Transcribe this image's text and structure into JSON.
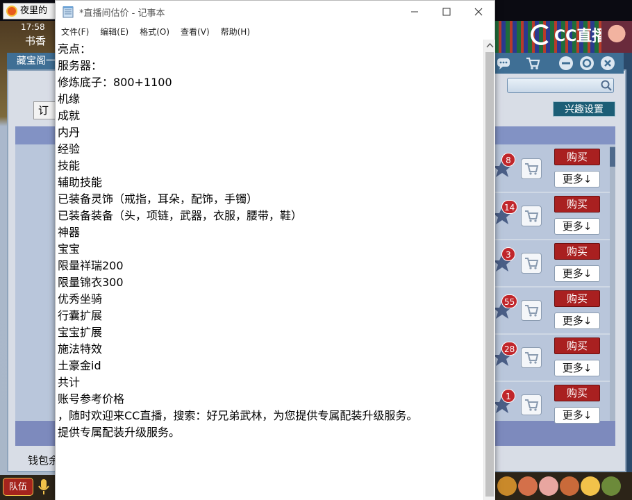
{
  "colors": {
    "buy_button": "#a92020",
    "badge": "#c0262b",
    "game_header": "#3f6f95",
    "list_header": "#8292c4",
    "notepad_bg": "#ffffff"
  },
  "game": {
    "tab_title": "夜里的",
    "clock": "17:58",
    "bookstore_label": "书香",
    "header_label": "藏宝阁一",
    "order_button": "订单",
    "interest_button": "兴趣设置",
    "wallet_label": "钱包余",
    "team_button": "队伍",
    "watermark": "CC直播",
    "header_icons": [
      "chat-icon",
      "cart-icon",
      "minimize-icon",
      "settings-icon",
      "close-icon"
    ],
    "rows": [
      {
        "badge": "8",
        "buy": "购买",
        "more": "更多↓"
      },
      {
        "badge": "14",
        "buy": "购买",
        "more": "更多↓"
      },
      {
        "badge": "3",
        "buy": "购买",
        "more": "更多↓"
      },
      {
        "badge": "55",
        "buy": "购买",
        "more": "更多↓"
      },
      {
        "badge": "28",
        "buy": "购买",
        "more": "更多↓"
      },
      {
        "badge": "1",
        "buy": "购买",
        "more": "更多↓"
      }
    ]
  },
  "notepad": {
    "title": "*直播间估价 - 记事本",
    "menu": [
      "文件(F)",
      "编辑(E)",
      "格式(O)",
      "查看(V)",
      "帮助(H)"
    ],
    "lines": [
      "亮点：",
      "服务器：",
      "修炼底子：800+1100",
      "机缘",
      "成就",
      "内丹",
      "经验",
      "技能",
      "辅助技能",
      "已装备灵饰（戒指，耳朵，配饰，手镯）",
      "已装备装备（头，项链，武器，衣服，腰带，鞋）",
      "神器",
      "宝宝",
      "限量祥瑞200",
      "限量锦衣300",
      "优秀坐骑",
      "行囊扩展",
      "宝宝扩展",
      "施法特效",
      "土豪金id",
      "共计",
      "账号参考价格",
      "，随时欢迎来CC直播，搜索：好兄弟武林，为您提供专属配装升级服务。",
      "提供专属配装升级服务。"
    ]
  }
}
